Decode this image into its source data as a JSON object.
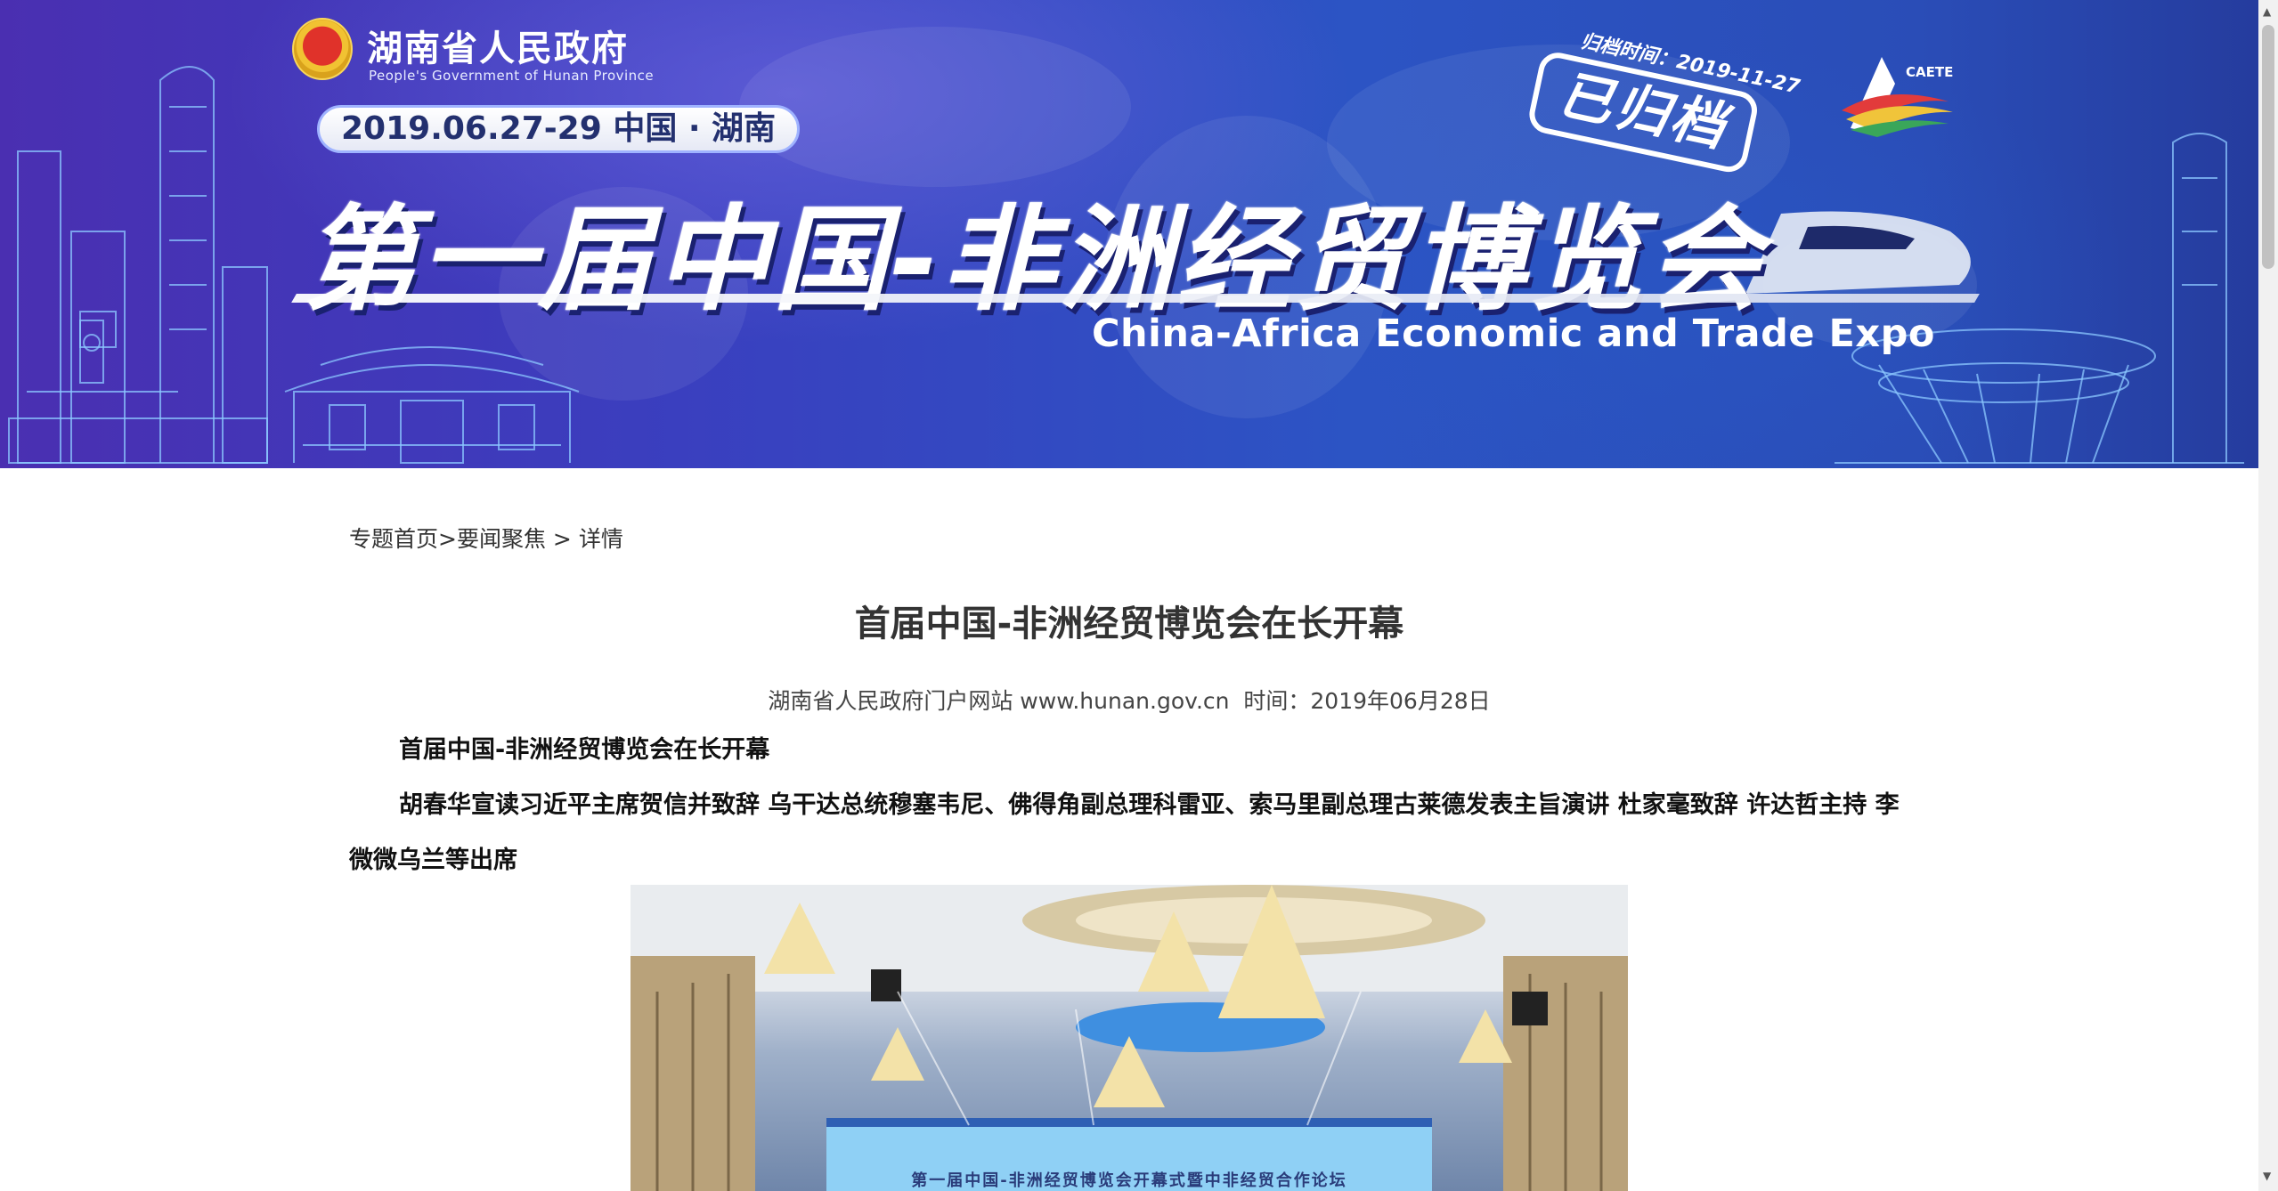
{
  "banner": {
    "gov_title": "湖南省人民政府",
    "gov_subtitle": "People's Government of Hunan Province",
    "date_location": "2019.06.27-29 中国 · 湖南",
    "expo_title_cn": "第一届中国-非洲经贸博览会",
    "expo_title_en": "China-Africa Economic and Trade Expo",
    "archive_time": "归档时间：2019-11-27",
    "archive_stamp": "已归档",
    "logo_text": "CAETE",
    "logo_icon": "caete-logo-icon",
    "emblem_icon": "national-emblem-icon"
  },
  "breadcrumb": {
    "home": "专题首页",
    "sep1": ">",
    "section": "要闻聚焦",
    "sep2": " > ",
    "current": "详情"
  },
  "article": {
    "title": "首届中国-非洲经贸博览会在长开幕",
    "meta": "湖南省人民政府门户网站 www.hunan.gov.cn  时间：2019年06月28日",
    "paragraph1": "首届中国-非洲经贸博览会在长开幕",
    "paragraph2": "胡春华宣读习近平主席贺信并致辞 乌干达总统穆塞韦尼、佛得角副总理科雷亚、索马里副总理古莱德发表主旨演讲 杜家毫致辞 许达哲主持 李微微乌兰等出席",
    "photo_screen_text": "第一届中国-非洲经贸博览会开幕式暨中非经贸合作论坛"
  },
  "colors": {
    "banner_start": "#4a2fb1",
    "banner_end": "#253c9e",
    "text_main": "#333333"
  }
}
